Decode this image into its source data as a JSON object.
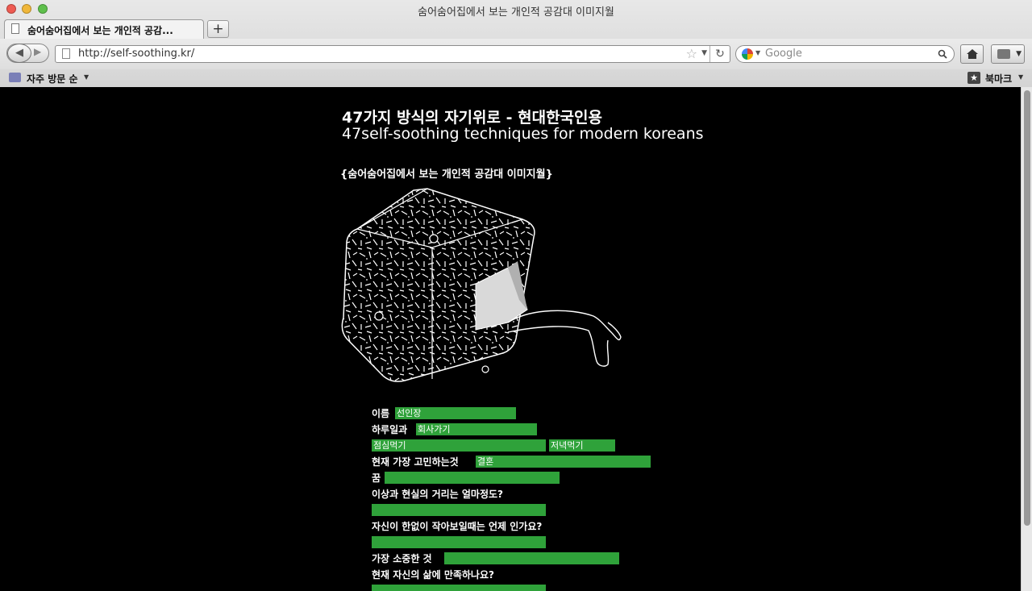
{
  "window": {
    "title": "숨어숨어집에서 보는 개인적 공감대 이미지월"
  },
  "tab": {
    "label": "숨어숨어집에서 보는 개인적 공감...",
    "new_tab": "+"
  },
  "nav": {
    "url": "http://self-soothing.kr/",
    "search_placeholder": "Google"
  },
  "bookmarks": {
    "left_label": "자주 방문 순",
    "right_label": "북마크"
  },
  "page": {
    "heading_ko": "47가지 방식의 자기위로 - 현대한국인용",
    "heading_en": "47self-soothing techniques for modern koreans",
    "subtitle": "{숨어숨어집에서 보는 개인적 공감대 이미지월}"
  },
  "form": {
    "name_label": "이름",
    "name_value": "선인장",
    "daily_label": "하루일과",
    "daily_value": "회사가기",
    "lunch_value": "점심먹기",
    "dinner_value": "저녁먹기",
    "worry_label": "현재 가장 고민하는것",
    "worry_value": "결혼",
    "dream_label": "꿈",
    "dream_value": "",
    "distance_label": "이상과 현실의 거리는 얼마정도?",
    "distance_value": "",
    "small_label": "자신이 한없이 작아보일때는 언제 인가요?",
    "small_value": "",
    "precious_label": "가장 소중한 것",
    "precious_value": "",
    "satisfied_label": "현재 자신의 삶에 만족하나요?",
    "satisfied_value": ""
  },
  "colors": {
    "field_green": "#2fa23a",
    "page_bg": "#000000"
  },
  "icons": [
    "page-icon",
    "star-icon",
    "reload-icon",
    "google-icon",
    "search-icon",
    "home-icon",
    "addon-icon",
    "bookmark-folder-icon",
    "bookmark-star-icon"
  ]
}
